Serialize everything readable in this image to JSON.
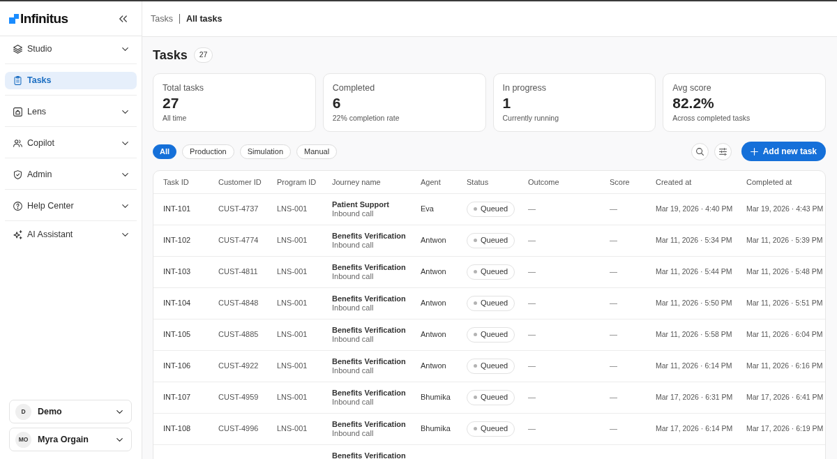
{
  "sidebar": {
    "brand": "Infinitus",
    "items": [
      {
        "label": "Studio",
        "selected": false,
        "expandable": true
      },
      {
        "label": "Tasks",
        "selected": true,
        "expandable": false
      },
      {
        "label": "Lens",
        "selected": false,
        "expandable": true
      },
      {
        "label": "Copilot",
        "selected": false,
        "expandable": true
      },
      {
        "label": "Admin",
        "selected": false,
        "expandable": true
      },
      {
        "label": "Help Center",
        "selected": false,
        "expandable": true
      },
      {
        "label": "AI Assistant",
        "selected": false,
        "expandable": true
      }
    ],
    "accounts": [
      {
        "initials": "D",
        "name": "Demo"
      },
      {
        "initials": "MO",
        "name": "Myra Orgain"
      }
    ]
  },
  "breadcrumb": [
    "Tasks",
    "All tasks"
  ],
  "page": {
    "title": "Tasks",
    "count": "27"
  },
  "stats": [
    {
      "label": "Total tasks",
      "value": "27",
      "note": "All time"
    },
    {
      "label": "Completed",
      "value": "6",
      "note": "22% completion rate"
    },
    {
      "label": "In progress",
      "value": "1",
      "note": "Currently running"
    },
    {
      "label": "Avg score",
      "value": "82.2%",
      "note": "Across completed tasks"
    }
  ],
  "filters": [
    {
      "label": "All",
      "selected": true
    },
    {
      "label": "Production",
      "selected": false
    },
    {
      "label": "Simulation",
      "selected": false
    },
    {
      "label": "Manual",
      "selected": false
    }
  ],
  "actions": {
    "add_label": "Add new task"
  },
  "table": {
    "columns": [
      "Task ID",
      "Customer ID",
      "Program ID",
      "Journey name",
      "Agent",
      "Status",
      "Outcome",
      "Score",
      "Created at",
      "Completed at"
    ],
    "rows": [
      {
        "task_id": "INT-101",
        "customer_id": "CUST-4737",
        "program_id": "LNS-001",
        "journey": "Patient Support",
        "call_type": "Inbound call",
        "agent": "Eva",
        "status": "Queued",
        "outcome": "—",
        "score": "—",
        "created_at": "Mar 19, 2026 · 4:40 PM",
        "completed_at": "Mar 19, 2026 · 4:43 PM"
      },
      {
        "task_id": "INT-102",
        "customer_id": "CUST-4774",
        "program_id": "LNS-001",
        "journey": "Benefits Verification",
        "call_type": "Inbound call",
        "agent": "Antwon",
        "status": "Queued",
        "outcome": "—",
        "score": "—",
        "created_at": "Mar 11, 2026 · 5:34 PM",
        "completed_at": "Mar 11, 2026 · 5:39 PM"
      },
      {
        "task_id": "INT-103",
        "customer_id": "CUST-4811",
        "program_id": "LNS-001",
        "journey": "Benefits Verification",
        "call_type": "Inbound call",
        "agent": "Antwon",
        "status": "Queued",
        "outcome": "—",
        "score": "—",
        "created_at": "Mar 11, 2026 · 5:44 PM",
        "completed_at": "Mar 11, 2026 · 5:48 PM"
      },
      {
        "task_id": "INT-104",
        "customer_id": "CUST-4848",
        "program_id": "LNS-001",
        "journey": "Benefits Verification",
        "call_type": "Inbound call",
        "agent": "Antwon",
        "status": "Queued",
        "outcome": "—",
        "score": "—",
        "created_at": "Mar 11, 2026 · 5:50 PM",
        "completed_at": "Mar 11, 2026 · 5:51 PM"
      },
      {
        "task_id": "INT-105",
        "customer_id": "CUST-4885",
        "program_id": "LNS-001",
        "journey": "Benefits Verification",
        "call_type": "Inbound call",
        "agent": "Antwon",
        "status": "Queued",
        "outcome": "—",
        "score": "—",
        "created_at": "Mar 11, 2026 · 5:58 PM",
        "completed_at": "Mar 11, 2026 · 6:04 PM"
      },
      {
        "task_id": "INT-106",
        "customer_id": "CUST-4922",
        "program_id": "LNS-001",
        "journey": "Benefits Verification",
        "call_type": "Inbound call",
        "agent": "Antwon",
        "status": "Queued",
        "outcome": "—",
        "score": "—",
        "created_at": "Mar 11, 2026 · 6:14 PM",
        "completed_at": "Mar 11, 2026 · 6:16 PM"
      },
      {
        "task_id": "INT-107",
        "customer_id": "CUST-4959",
        "program_id": "LNS-001",
        "journey": "Benefits Verification",
        "call_type": "Inbound call",
        "agent": "Bhumika",
        "status": "Queued",
        "outcome": "—",
        "score": "—",
        "created_at": "Mar 17, 2026 · 6:31 PM",
        "completed_at": "Mar 17, 2026 · 6:41 PM"
      },
      {
        "task_id": "INT-108",
        "customer_id": "CUST-4996",
        "program_id": "LNS-001",
        "journey": "Benefits Verification",
        "call_type": "Inbound call",
        "agent": "Bhumika",
        "status": "Queued",
        "outcome": "—",
        "score": "—",
        "created_at": "Mar 17, 2026 · 6:14 PM",
        "completed_at": "Mar 17, 2026 · 6:19 PM"
      },
      {
        "journey": "Benefits Verification"
      }
    ]
  }
}
